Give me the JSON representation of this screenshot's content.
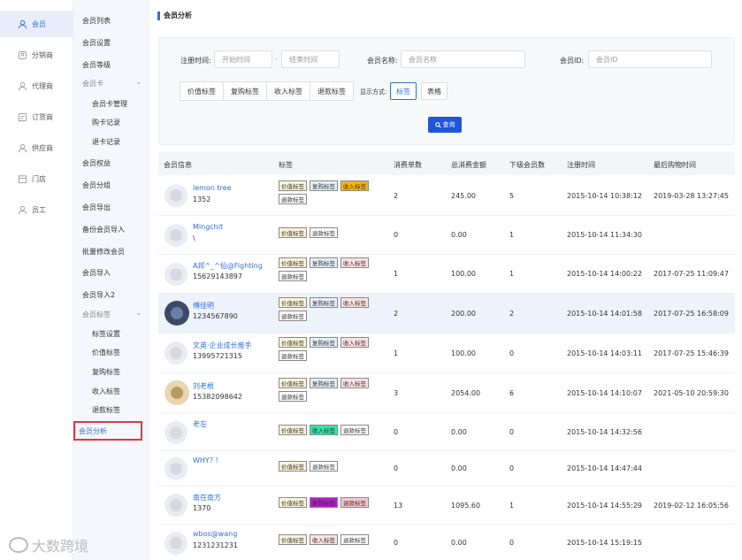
{
  "rail": {
    "items": [
      {
        "label": "会员",
        "icon": "user-icon",
        "active": true
      },
      {
        "label": "分销商",
        "icon": "distributor-icon",
        "active": false
      },
      {
        "label": "代理商",
        "icon": "agent-icon",
        "active": false
      },
      {
        "label": "订货商",
        "icon": "orderer-icon",
        "active": false
      },
      {
        "label": "供应商",
        "icon": "supplier-icon",
        "active": false
      },
      {
        "label": "门店",
        "icon": "store-icon",
        "active": false
      },
      {
        "label": "员工",
        "icon": "staff-icon",
        "active": false
      }
    ]
  },
  "subnav": {
    "items": [
      {
        "label": "会员列表"
      },
      {
        "label": "会员设置"
      },
      {
        "label": "会员等级"
      },
      {
        "label": "会员卡"
      },
      {
        "label": "会员卡管理"
      },
      {
        "label": "购卡记录"
      },
      {
        "label": "退卡记录"
      },
      {
        "label": "会员权益"
      },
      {
        "label": "会员分组"
      },
      {
        "label": "会员导出"
      },
      {
        "label": "备份会员导入"
      },
      {
        "label": "批量修改会员"
      },
      {
        "label": "会员导入"
      },
      {
        "label": "会员导入2"
      },
      {
        "label": "会员标签"
      },
      {
        "label": "标签设置"
      },
      {
        "label": "价值标签"
      },
      {
        "label": "复购标签"
      },
      {
        "label": "收入标签"
      },
      {
        "label": "退款标签"
      },
      {
        "label": "会员分析"
      }
    ]
  },
  "page": {
    "title": "会员分析"
  },
  "filter": {
    "reg_time_label": "注册时间:",
    "start_placeholder": "开始时间",
    "sep": "-",
    "end_placeholder": "结束时间",
    "name_label": "会员名称:",
    "name_placeholder": "会员名称",
    "id_label": "会员ID:",
    "id_placeholder": "会员ID",
    "tag_buttons": [
      "价值标签",
      "复购标签",
      "收入标签",
      "退款标签"
    ],
    "display_label": "显示方式:",
    "mode_tag": "标签",
    "mode_table": "表格",
    "query": "查询"
  },
  "table": {
    "headers": [
      "会员信息",
      "标签",
      "消费单数",
      "总消费金额",
      "下级会员数",
      "注册时间",
      "最后购物时间"
    ],
    "rows": [
      {
        "name": "lemon tree",
        "sub": "1352",
        "tags": [
          "价值标签",
          "复购标签",
          "收入标签",
          "退款标签"
        ],
        "orders": "2",
        "amount": "245.00",
        "subs": "5",
        "reg": "2015-10-14 10:38:12",
        "last": "2019-03-28 13:27:45"
      },
      {
        "name": "Mingchit",
        "sub": "\\",
        "tags": [
          "价值标签",
          "退款标签"
        ],
        "orders": "0",
        "amount": "0.00",
        "subs": "1",
        "reg": "2015-10-14 11:34:30",
        "last": ""
      },
      {
        "name": "A邦^_^仙@Fighting",
        "sub": "15629143897",
        "tags": [
          "价值标签",
          "复购标签",
          "收入标签",
          "退款标签"
        ],
        "orders": "1",
        "amount": "100.00",
        "subs": "1",
        "reg": "2015-10-14 14:00:22",
        "last": "2017-07-25 11:09:47"
      },
      {
        "name": "傅佳明",
        "sub": "1234567890",
        "tags": [
          "价值标签",
          "复购标签",
          "收入标签",
          "退款标签"
        ],
        "orders": "2",
        "amount": "200.00",
        "subs": "2",
        "reg": "2015-10-14 14:01:58",
        "last": "2017-07-25 16:58:09"
      },
      {
        "name": "文英·企业成长推手",
        "sub": "13995721315",
        "tags": [
          "价值标签",
          "复购标签",
          "收入标签",
          "退款标签"
        ],
        "orders": "1",
        "amount": "100.00",
        "subs": "0",
        "reg": "2015-10-14 14:03:11",
        "last": "2017-07-25 15:46:39"
      },
      {
        "name": "刘老根",
        "sub": "15382098642",
        "tags": [
          "价值标签",
          "复购标签",
          "收入标签",
          "退款标签"
        ],
        "orders": "3",
        "amount": "2054.00",
        "subs": "6",
        "reg": "2015-10-14 14:10:07",
        "last": "2021-05-10 20:59:30"
      },
      {
        "name": "老左",
        "sub": "",
        "tags": [
          "价值标签",
          "收入标签",
          "退款标签"
        ],
        "orders": "0",
        "amount": "0.00",
        "subs": "0",
        "reg": "2015-10-14 14:32:56",
        "last": ""
      },
      {
        "name": "WHY? !",
        "sub": "",
        "tags": [
          "价值标签",
          "退款标签"
        ],
        "orders": "0",
        "amount": "0.00",
        "subs": "0",
        "reg": "2015-10-14 14:47:44",
        "last": ""
      },
      {
        "name": "南在南方",
        "sub": "1370",
        "tags": [
          "价值标签",
          "复购标签",
          "退款标签"
        ],
        "orders": "13",
        "amount": "1095.60",
        "subs": "1",
        "reg": "2015-10-14 14:55:29",
        "last": "2019-02-12 16:05:56"
      },
      {
        "name": "wbos@wang",
        "sub": "1231231231",
        "tags": [
          "价值标签",
          "收入标签",
          "退款标签"
        ],
        "orders": "0",
        "amount": "0.00",
        "subs": "0",
        "reg": "2015-10-14 15:19:15",
        "last": ""
      }
    ]
  },
  "colors": {
    "accent": "#2f6fe2",
    "tag_value_bg": "#fdf3d8",
    "tag_repurchase_bg": "#e6f0fb",
    "tag_income_bg": "#fde2e2",
    "tag_orange": "#ffb300",
    "tag_green": "#2ee6a8",
    "tag_purple": "#b21ec6",
    "tag_pink": "#f9c7cd"
  },
  "watermark": "大数跨境"
}
